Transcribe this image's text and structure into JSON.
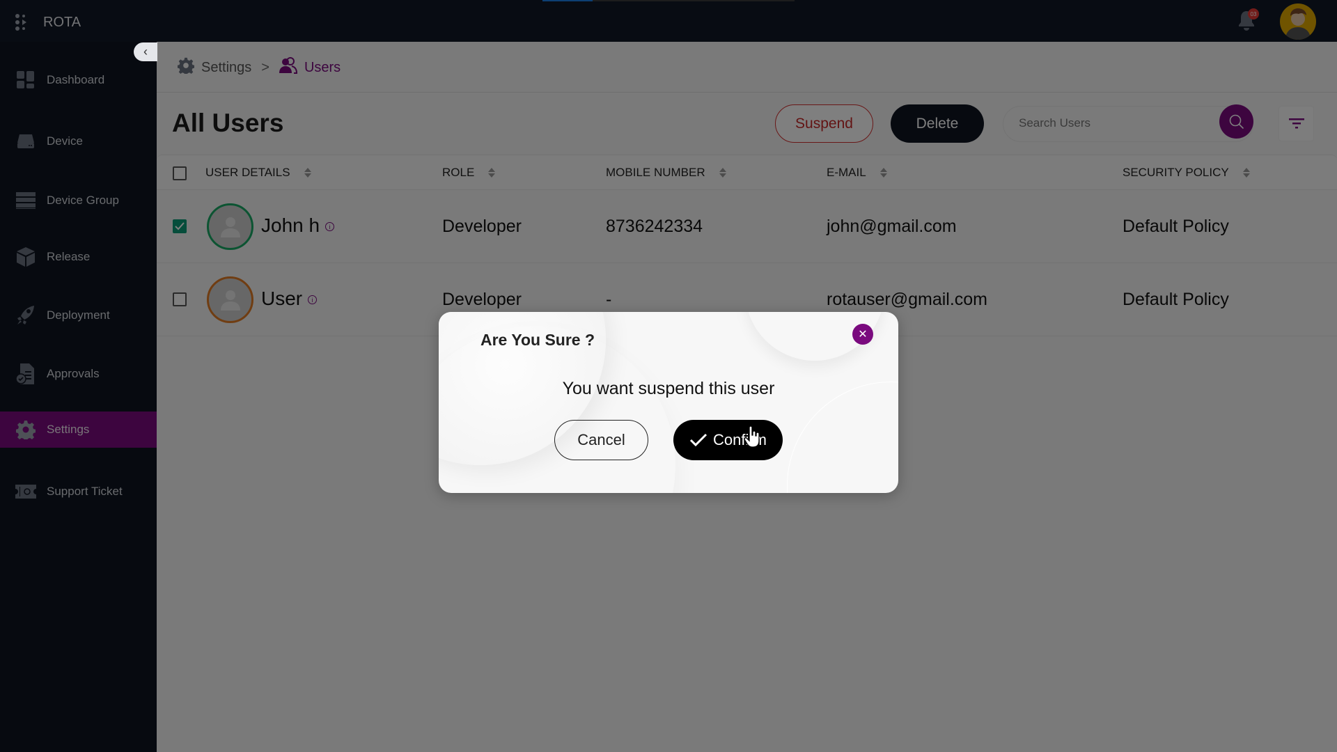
{
  "app": {
    "name": "ROTA"
  },
  "topbar": {
    "progress_percent": 20,
    "notification_count": "03",
    "icons": {
      "bell": "bell-icon",
      "avatar": "user-avatar"
    }
  },
  "sidebar": {
    "collapse_icon": "chevron-left-icon",
    "items": [
      {
        "label": "Dashboard",
        "icon": "dashboard-icon",
        "active": false
      },
      {
        "label": "Device",
        "icon": "device-icon",
        "active": false
      },
      {
        "label": "Device Group",
        "icon": "device-group-icon",
        "active": false
      },
      {
        "label": "Release",
        "icon": "box-icon",
        "active": false
      },
      {
        "label": "Deployment",
        "icon": "rocket-icon",
        "active": false
      },
      {
        "label": "Approvals",
        "icon": "approvals-icon",
        "active": false
      },
      {
        "label": "Settings",
        "icon": "gear-icon",
        "active": true
      },
      {
        "label": "Support Ticket",
        "icon": "ticket-icon",
        "active": false
      }
    ]
  },
  "breadcrumb": {
    "items": [
      {
        "label": "Settings",
        "icon": "gear-icon"
      },
      {
        "label": "Users",
        "icon": "users-icon"
      }
    ],
    "separator": ">"
  },
  "page": {
    "title": "All Users",
    "suspend_label": "Suspend",
    "delete_label": "Delete",
    "search_placeholder": "Search Users",
    "search_value": ""
  },
  "table": {
    "columns": [
      "USER DETAILS",
      "ROLE",
      "MOBILE NUMBER",
      "E-MAIL",
      "SECURITY POLICY"
    ],
    "rows": [
      {
        "checked": true,
        "name": "John h",
        "role": "Developer",
        "mobile": "8736242334",
        "email": "john@gmail.com",
        "policy": "Default Policy",
        "ring_color": "#19a865"
      },
      {
        "checked": false,
        "name": "User",
        "role": "Developer",
        "mobile": "-",
        "email": "rotauser@gmail.com",
        "policy": "Default Policy",
        "ring_color": "#e07b24"
      }
    ]
  },
  "modal": {
    "title": "Are You Sure ?",
    "message": "You want suspend this user",
    "cancel_label": "Cancel",
    "confirm_label": "Confirm"
  },
  "colors": {
    "accent": "#7a0a7e",
    "sidebar_bg": "#0f1420",
    "danger": "#c62828",
    "success": "#0d9a76"
  }
}
